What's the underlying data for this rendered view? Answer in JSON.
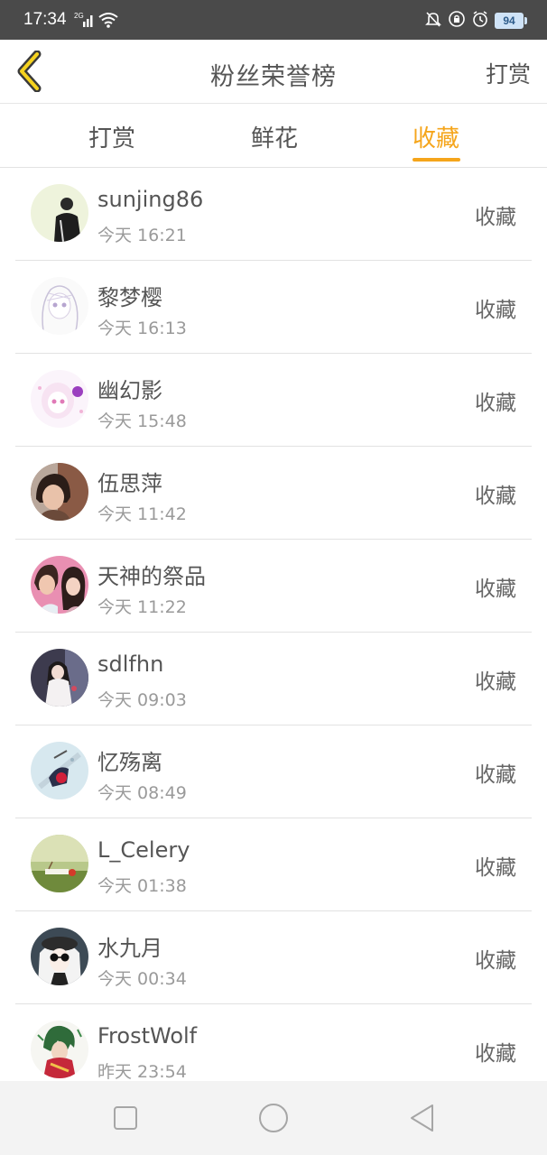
{
  "status_bar": {
    "time": "17:34",
    "network": "2G",
    "battery": "94",
    "icons": [
      "signal-icon",
      "wifi-icon",
      "mute-bell-icon",
      "lock-rotation-icon",
      "alarm-icon",
      "battery-icon"
    ]
  },
  "header": {
    "title": "粉丝荣誉榜",
    "action_label": "打赏",
    "back_icon": "chevron-left-icon"
  },
  "tabs": [
    {
      "label": "打赏",
      "active": false
    },
    {
      "label": "鲜花",
      "active": false
    },
    {
      "label": "收藏",
      "active": true
    }
  ],
  "accent_color": "#f5a51b",
  "fans": [
    {
      "name": "sunjing86",
      "time": "今天 16:21",
      "tag": "收藏"
    },
    {
      "name": "黎梦樱",
      "time": "今天 16:13",
      "tag": "收藏"
    },
    {
      "name": "幽幻影",
      "time": "今天 15:48",
      "tag": "收藏"
    },
    {
      "name": "伍思萍",
      "time": "今天 11:42",
      "tag": "收藏"
    },
    {
      "name": "天神的祭品",
      "time": "今天 11:22",
      "tag": "收藏"
    },
    {
      "name": "sdlfhn",
      "time": "今天 09:03",
      "tag": "收藏"
    },
    {
      "name": "忆殇离",
      "time": "今天 08:49",
      "tag": "收藏"
    },
    {
      "name": "L_Celery",
      "time": "今天 01:38",
      "tag": "收藏"
    },
    {
      "name": "水九月",
      "time": "今天 00:34",
      "tag": "收藏"
    },
    {
      "name": "FrostWolf",
      "time": "昨天 23:54",
      "tag": "收藏"
    }
  ],
  "nav_bar": {
    "icons": [
      "recent-apps-icon",
      "home-icon",
      "back-icon"
    ]
  }
}
